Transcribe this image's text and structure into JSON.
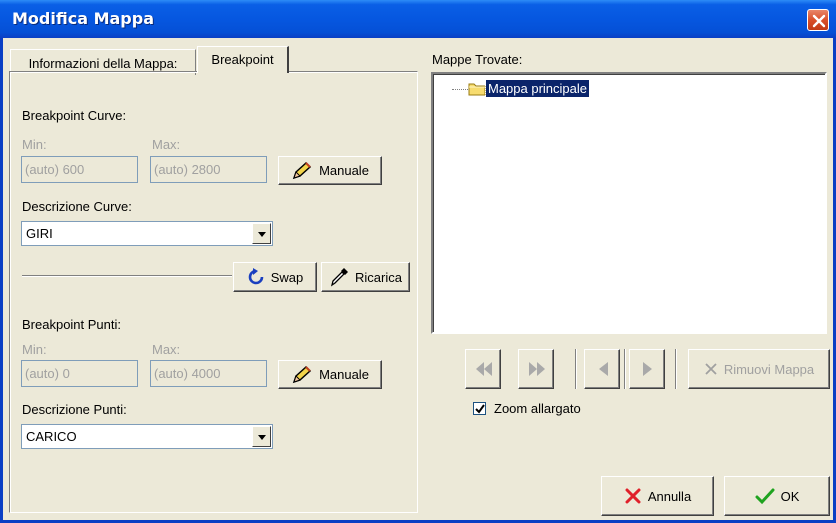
{
  "window": {
    "title": "Modifica Mappa"
  },
  "tabs": [
    {
      "label": "Informazioni della Mappa:"
    },
    {
      "label": "Breakpoint"
    }
  ],
  "curve": {
    "section_label": "Breakpoint Curve:",
    "min_label": "Min:",
    "max_label": "Max:",
    "min_value": "(auto) 600",
    "max_value": "(auto) 2800",
    "manual_button": "Manuale",
    "desc_label": "Descrizione Curve:",
    "desc_value": "GIRI"
  },
  "actions": {
    "swap": "Swap",
    "reload": "Ricarica"
  },
  "points": {
    "section_label": "Breakpoint Punti:",
    "min_label": "Min:",
    "max_label": "Max:",
    "min_value": "(auto) 0",
    "max_value": "(auto) 4000",
    "manual_button": "Manuale",
    "desc_label": "Descrizione Punti:",
    "desc_value": "CARICO"
  },
  "maps": {
    "label": "Mappe Trovate:",
    "items": [
      {
        "label": "Mappa principale",
        "icon": "folder-icon",
        "selected": true
      }
    ]
  },
  "nav": {
    "remove_button": "Rimuovi Mappa",
    "icons": [
      "first-icon",
      "last-icon",
      "prev-icon",
      "next-icon"
    ]
  },
  "zoom": {
    "label": "Zoom allargato",
    "checked": true
  },
  "footer": {
    "cancel": "Annulla",
    "ok": "OK"
  },
  "colors": {
    "title_bar": "#0657e0",
    "selection": "#0a246a",
    "cancel_x": "#e0202a",
    "ok_check": "#1fa31f"
  }
}
